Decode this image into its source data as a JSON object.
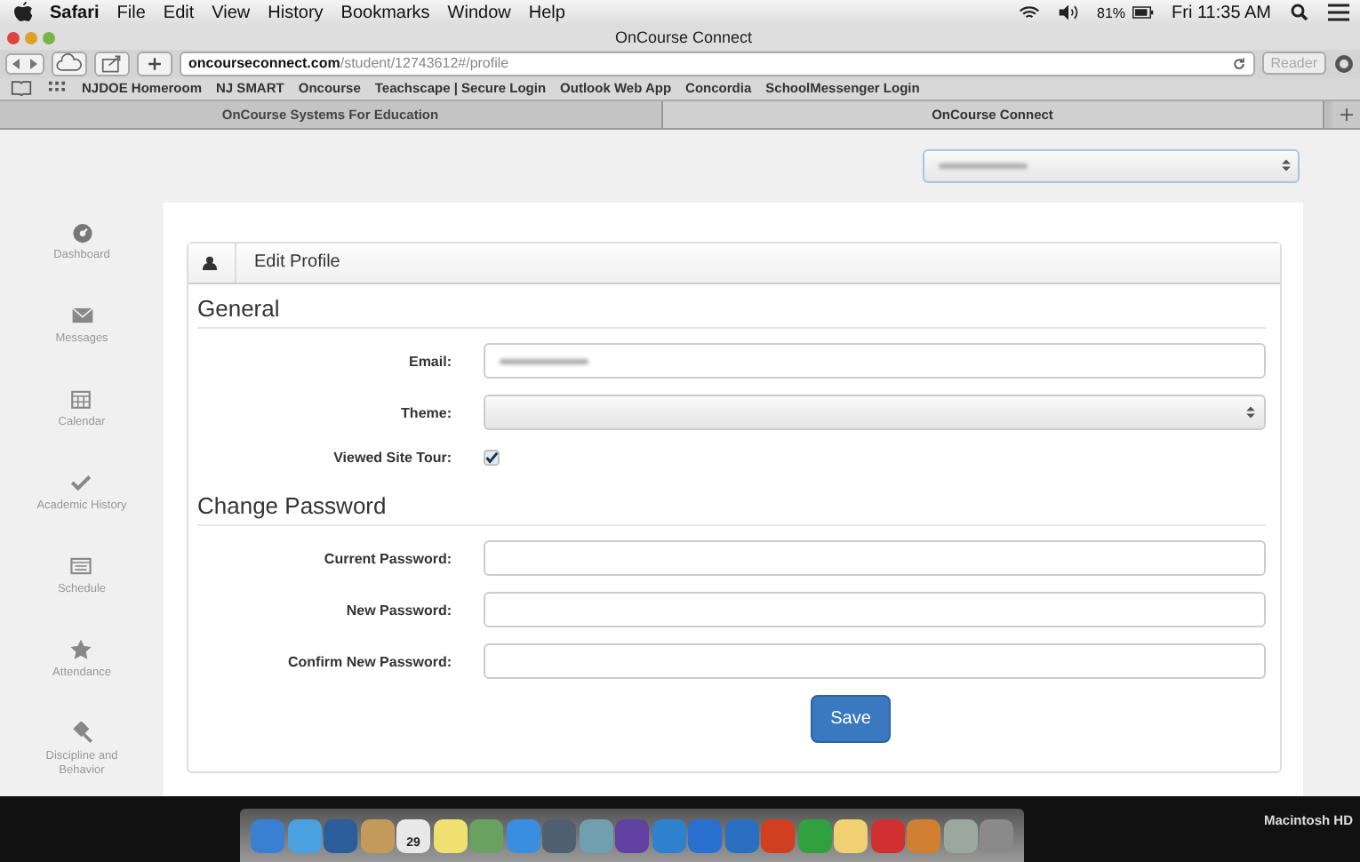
{
  "menu_bar": {
    "app": "Safari",
    "items": [
      "File",
      "Edit",
      "View",
      "History",
      "Bookmarks",
      "Window",
      "Help"
    ],
    "battery": "81%",
    "clock": "Fri 11:35 AM"
  },
  "window": {
    "title": "OnCourse Connect"
  },
  "toolbar": {
    "url_host": "oncourseconnect.com",
    "url_path": "/student/12743612#/profile",
    "reader": "Reader"
  },
  "bookmarks": [
    "NJDOE Homeroom",
    "NJ SMART",
    "Oncourse",
    "Teachscape | Secure Login",
    "Outlook Web App",
    "Concordia",
    "SchoolMessenger Login"
  ],
  "tabs": [
    {
      "label": "OnCourse Systems For Education",
      "selected": false
    },
    {
      "label": "OnCourse Connect",
      "selected": true
    }
  ],
  "sidebar": {
    "items": [
      {
        "label": "Dashboard",
        "kind": "dashboard"
      },
      {
        "label": "Messages",
        "kind": "messages"
      },
      {
        "label": "Calendar",
        "kind": "calendar"
      },
      {
        "label": "Academic History",
        "kind": "check"
      },
      {
        "label": "Schedule",
        "kind": "schedule"
      },
      {
        "label": "Attendance",
        "kind": "star"
      },
      {
        "label": "Discipline and Behavior",
        "kind": "gavel"
      }
    ]
  },
  "panel": {
    "title": "Edit Profile",
    "sections": [
      {
        "heading": "General",
        "fields": [
          {
            "label": "Email:",
            "kind": "text"
          },
          {
            "label": "Theme:",
            "kind": "select"
          },
          {
            "label": "Viewed Site Tour:",
            "kind": "checkbox",
            "checked": true
          }
        ]
      },
      {
        "heading": "Change Password",
        "fields": [
          {
            "label": "Current Password:",
            "kind": "text"
          },
          {
            "label": "New Password:",
            "kind": "text"
          },
          {
            "label": "Confirm New Password:",
            "kind": "text"
          }
        ]
      }
    ],
    "save": "Save"
  },
  "dock": {
    "calendar_date": "29",
    "drive": "Macintosh HD"
  }
}
